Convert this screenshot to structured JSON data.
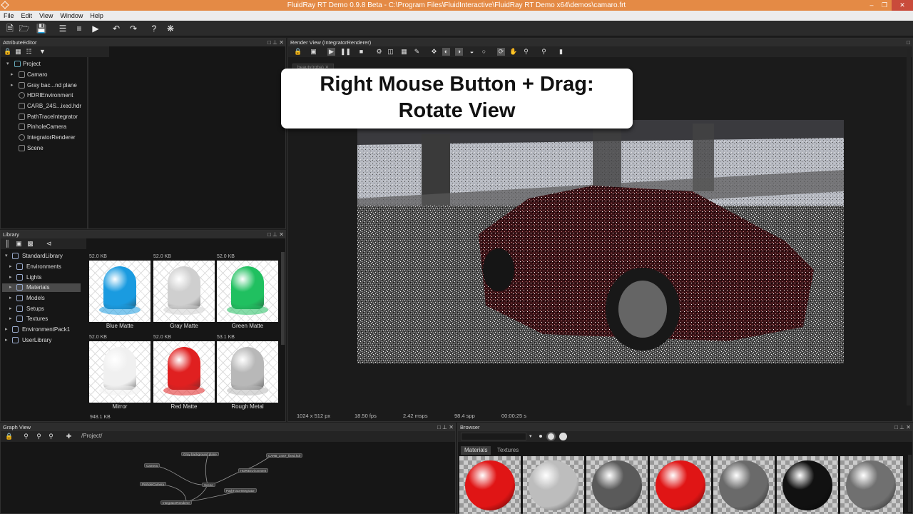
{
  "window": {
    "title": "FluidRay RT Demo 0.9.8 Beta - C:\\Program Files\\FluidInteractive\\FluidRay RT Demo x64\\demos\\camaro.frt"
  },
  "menu": [
    "File",
    "Edit",
    "View",
    "Window",
    "Help"
  ],
  "toolbar_icons": [
    "new-file-icon",
    "open-folder-icon",
    "save-icon",
    "layers-icon",
    "settings-sliders-icon",
    "render-play-icon",
    "undo-icon",
    "redo-icon",
    "help-icon",
    "bug-icon"
  ],
  "attribute_editor": {
    "title": "AttributeEditor",
    "tree": [
      "Project",
      "Camaro",
      "Gray bac...nd plane",
      "HDRIEnvironment",
      "CARB_24S...ixed.hdr",
      "PathTraceIntegrator",
      "PinholeCamera",
      "IntegratorRenderer",
      "Scene"
    ]
  },
  "library": {
    "title": "Library",
    "tree": [
      "StandardLibrary",
      "Environments",
      "Lights",
      "Materials",
      "Models",
      "Setups",
      "Textures",
      "EnvironmentPack1",
      "UserLibrary"
    ],
    "selected": "Materials",
    "materials": [
      {
        "size": "52.0 KB",
        "name": "Blue Matte",
        "color": "#1a9be0"
      },
      {
        "size": "52.0 KB",
        "name": "Gray Matte",
        "color": "#cfcfcf"
      },
      {
        "size": "52.0 KB",
        "name": "Green Matte",
        "color": "#20c060"
      },
      {
        "size": "52.0 KB",
        "name": "Mirror",
        "color": "#f0f0f0"
      },
      {
        "size": "52.0 KB",
        "name": "Red Matte",
        "color": "#e02020"
      },
      {
        "size": "53.1 KB",
        "name": "Rough Metal",
        "color": "#b8b8b8"
      }
    ],
    "footer_size": "948.1 KB"
  },
  "render_view": {
    "title": "Render View (IntegratorRenderer)",
    "tab": "beauty(rgba)",
    "callout_line1": "Right Mouse Button + Drag:",
    "callout_line2": "Rotate View",
    "status": {
      "resolution": "1024 x 512 px",
      "fps": "18.50 fps",
      "msps": "2.42 msps",
      "spp": "98.4 spp",
      "time": "00:00:25 s"
    }
  },
  "graph_view": {
    "title": "Graph View",
    "path": "/Project/",
    "nodes": [
      "Camera",
      "Gray background plane",
      "CARB_24S7_fixed.hdr",
      "HDRIEnvironment",
      "Scene",
      "PinholeCamera",
      "PathTraceIntegrator",
      "IntegratorRenderer"
    ]
  },
  "browser": {
    "title": "Browser",
    "tabs": [
      "Materials",
      "Textures"
    ],
    "selected_tab": "Materials",
    "swatches": [
      {
        "color": "#e01515"
      },
      {
        "color": "#bdbdbd"
      },
      {
        "color": "#5a5a5a"
      },
      {
        "color": "#e01515"
      },
      {
        "color": "#6a6a6a"
      },
      {
        "color": "#111111"
      },
      {
        "color": "#707070"
      }
    ]
  }
}
